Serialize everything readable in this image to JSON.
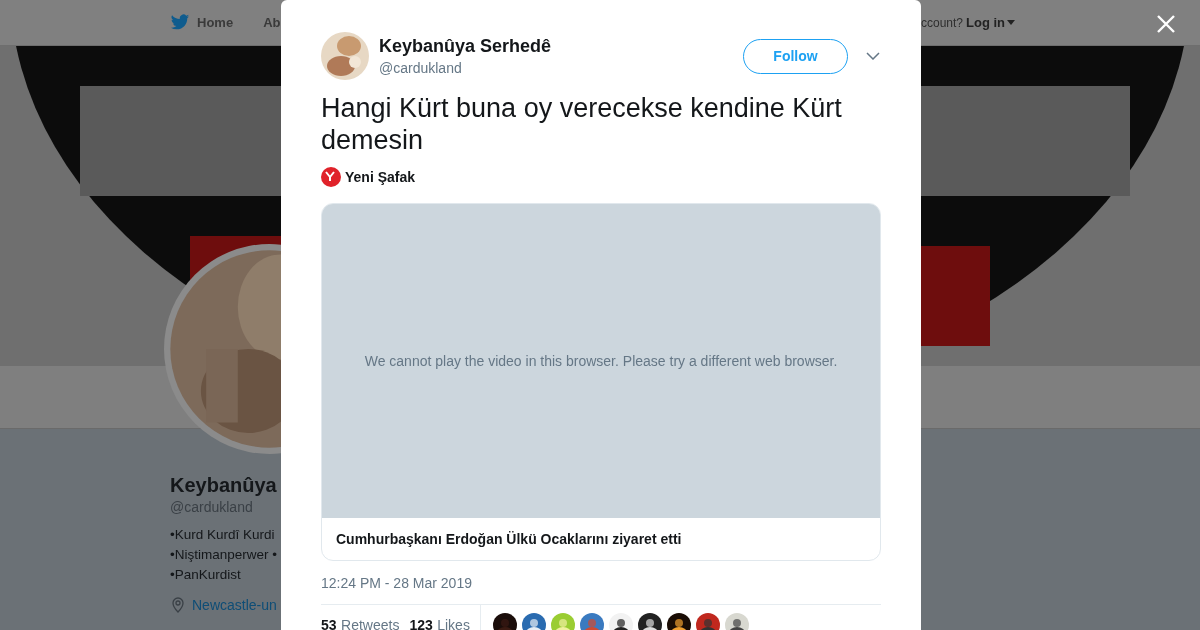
{
  "background_page": {
    "nav": {
      "items": [
        {
          "label": "Home",
          "kind": "home"
        },
        {
          "label": "Ab",
          "kind": "plain"
        }
      ],
      "account_prompt": "ccount?",
      "login": "Log in"
    },
    "profile": {
      "name": "Keybanûya",
      "handle": "@cardukland",
      "bio": [
        "•Kurd Kurdî Kurdi",
        "•Niştimanperwer •",
        "•PanKurdist"
      ],
      "location": "Newcastle-un"
    }
  },
  "tweet": {
    "author": {
      "name": "Keybanûya Serhedê",
      "handle": "@cardukland"
    },
    "follow_button": "Follow",
    "text": "Hangi Kürt buna oy verecekse kendine Kürt demesin",
    "source": "Yeni Şafak",
    "video": {
      "message": "We cannot play the video in this browser. Please try a different web browser.",
      "caption": "Cumhurbaşkanı Erdoğan Ülkü Ocaklarını ziyaret etti"
    },
    "timestamp": "12:24 PM - 28 Mar 2019",
    "stats": [
      {
        "count": "53",
        "label": "Retweets"
      },
      {
        "count": "123",
        "label": "Likes"
      }
    ]
  }
}
